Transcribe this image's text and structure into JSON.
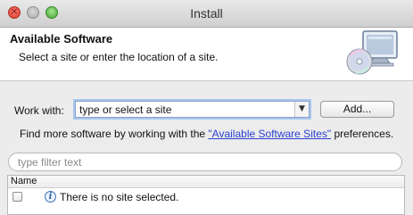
{
  "window": {
    "title": "Install",
    "controls": {
      "close_icon": "close-icon",
      "minimize_icon": "minimize-icon",
      "maximize_icon": "maximize-icon"
    }
  },
  "banner": {
    "title": "Available Software",
    "description": "Select a site or enter the location of a site.",
    "icon": "monitor-cd-icon"
  },
  "work_with": {
    "label": "Work with:",
    "value": "type or select a site",
    "dropdown_icon": "chevron-down-icon",
    "add_button_label": "Add..."
  },
  "find_more": {
    "prefix": "Find more software by working with the ",
    "link": "\"Available Software Sites\"",
    "suffix": " preferences."
  },
  "filter": {
    "placeholder": "type filter text",
    "value": ""
  },
  "table": {
    "columns": [
      "Name"
    ],
    "rows": [
      {
        "icon": "info-icon",
        "text": "There is no site selected."
      }
    ]
  },
  "colors": {
    "link": "#2a3fd0",
    "focus_ring": "#a9c6ef"
  }
}
